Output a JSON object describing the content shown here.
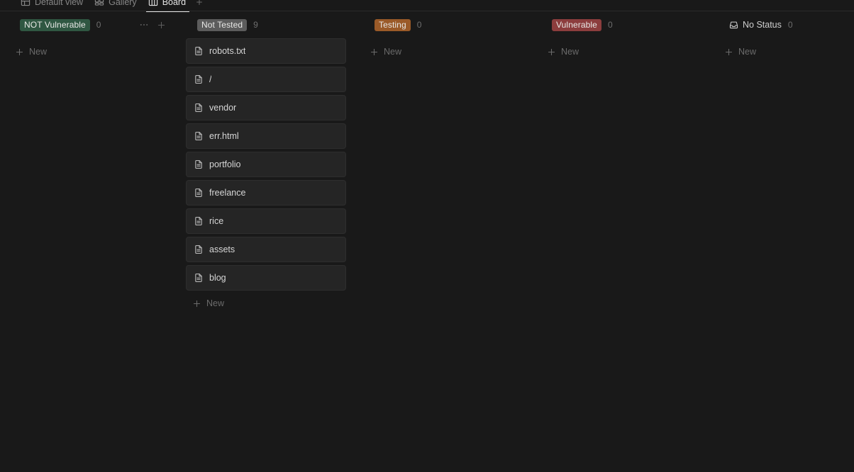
{
  "view_tabs": [
    {
      "label": "Default view",
      "icon": "table-icon",
      "active": false
    },
    {
      "label": "Gallery",
      "icon": "gallery-icon",
      "active": false
    },
    {
      "label": "Board",
      "icon": "board-icon",
      "active": true
    }
  ],
  "add_view_label": "+",
  "new_label": "New",
  "card_icon": "document-icon",
  "columns": [
    {
      "id": "not-vulnerable",
      "title": "NOT Vulnerable",
      "count": "0",
      "badge_color": "#2f5742",
      "has_badge": true,
      "icon": "",
      "show_actions": true,
      "cards": []
    },
    {
      "id": "not-tested",
      "title": "Not Tested",
      "count": "9",
      "badge_color": "#5c5c5c",
      "has_badge": true,
      "icon": "",
      "show_actions": false,
      "cards": [
        {
          "title": "robots.txt"
        },
        {
          "title": "/"
        },
        {
          "title": "vendor"
        },
        {
          "title": "err.html"
        },
        {
          "title": "portfolio"
        },
        {
          "title": "freelance"
        },
        {
          "title": "rice"
        },
        {
          "title": "assets"
        },
        {
          "title": "blog"
        }
      ]
    },
    {
      "id": "testing",
      "title": "Testing",
      "count": "0",
      "badge_color": "#9a5a28",
      "has_badge": true,
      "icon": "",
      "show_actions": false,
      "cards": []
    },
    {
      "id": "vulnerable",
      "title": "Vulnerable",
      "count": "0",
      "badge_color": "#8c3d3d",
      "has_badge": true,
      "icon": "",
      "show_actions": false,
      "cards": []
    },
    {
      "id": "no-status",
      "title": "No Status",
      "count": "0",
      "badge_color": "",
      "has_badge": false,
      "icon": "inbox-icon",
      "show_actions": false,
      "cards": []
    }
  ],
  "colors": {
    "background": "#191919",
    "card_bg": "#252525",
    "card_border": "#2e2e2e",
    "text_primary": "#d6d6d6",
    "text_muted": "#6e6e6e",
    "active_tab_underline": "#e8e8e8"
  }
}
